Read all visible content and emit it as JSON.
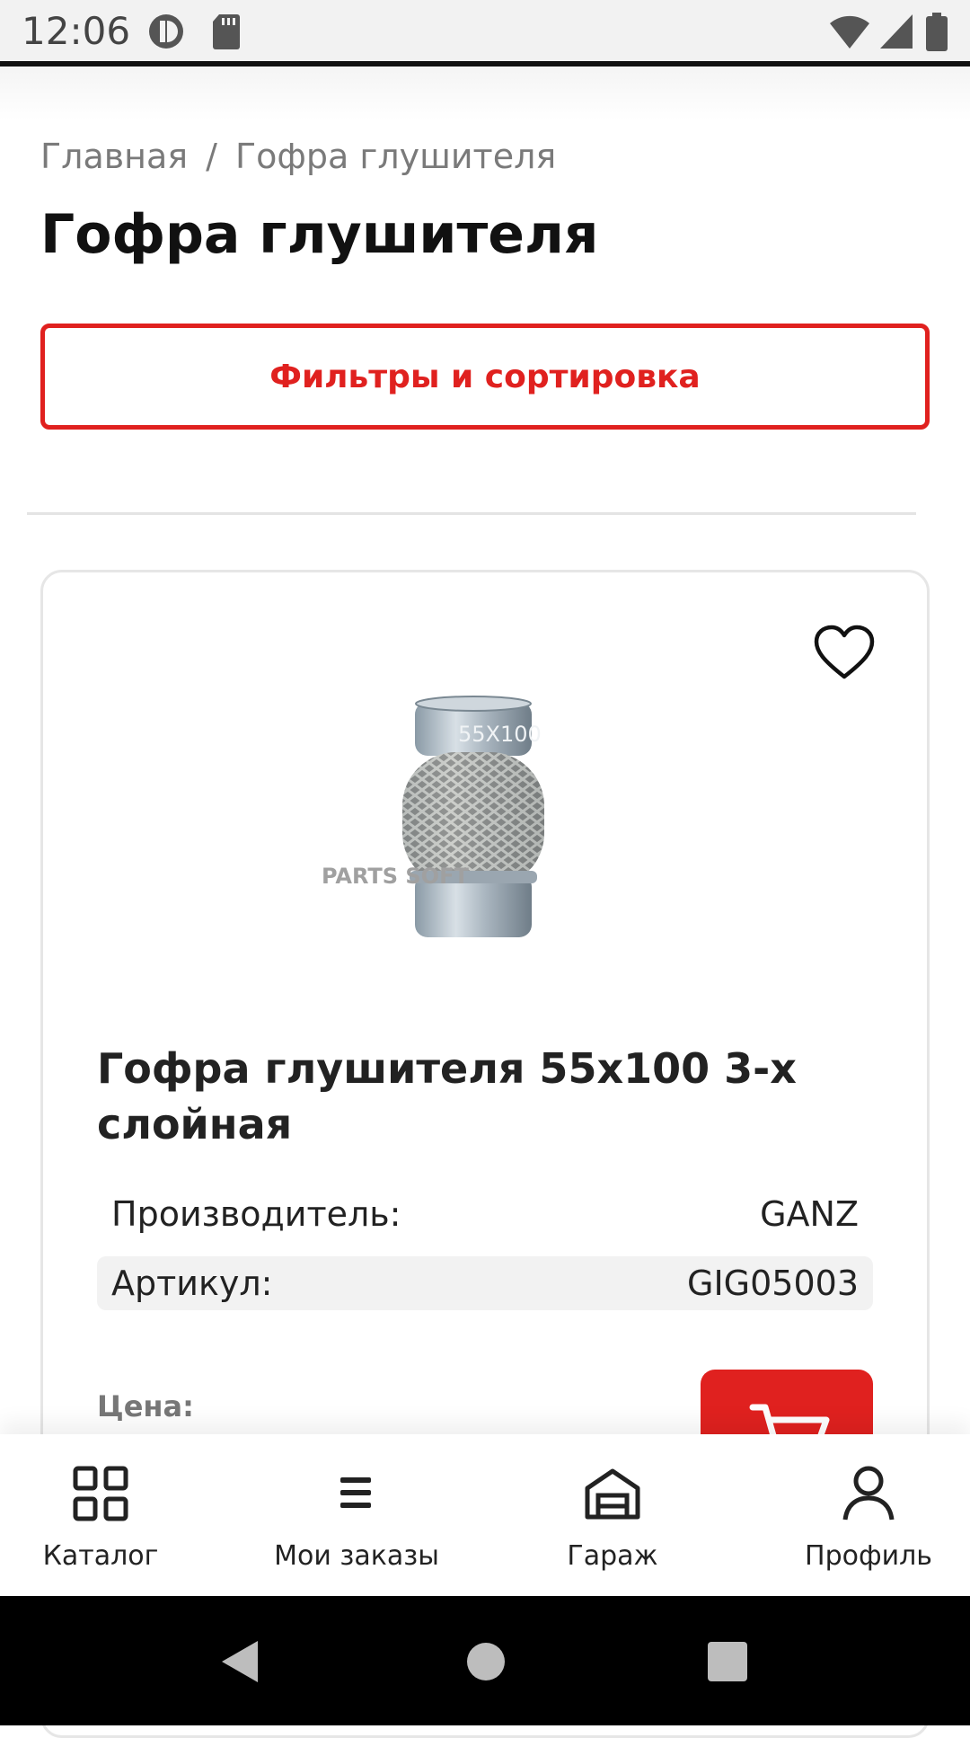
{
  "status_bar": {
    "time": "12:06",
    "icons": [
      "notification-app-icon",
      "sd-card-icon",
      "wifi-icon",
      "cell-signal-icon",
      "battery-icon"
    ]
  },
  "breadcrumb": {
    "home": "Главная",
    "separator": "/",
    "current": "Гофра глушителя"
  },
  "page_title": "Гофра глушителя",
  "filter_button": "Фильтры и сортировка",
  "colors": {
    "accent": "#e0211f",
    "muted_text": "#7a7a7a",
    "row_bg": "#f2f2f2"
  },
  "product": {
    "title": "Гофра глушителя 55х100 3-х слойная",
    "image_watermark": "PARTS SOFT",
    "image_marking": "55X100",
    "specs": [
      {
        "label": "Производитель:",
        "value": "GANZ"
      },
      {
        "label": "Артикул:",
        "value": "GIG05003"
      }
    ],
    "price_label": "Цена:",
    "favorite_icon": "heart-icon",
    "cart_icon": "cart-icon"
  },
  "bottom_nav": [
    {
      "label": "Каталог",
      "icon": "grid-icon"
    },
    {
      "label": "Мои заказы",
      "icon": "list-icon"
    },
    {
      "label": "Гараж",
      "icon": "garage-icon"
    },
    {
      "label": "Профиль",
      "icon": "user-icon"
    }
  ],
  "system_nav": [
    "back-icon",
    "home-icon",
    "recents-icon"
  ]
}
